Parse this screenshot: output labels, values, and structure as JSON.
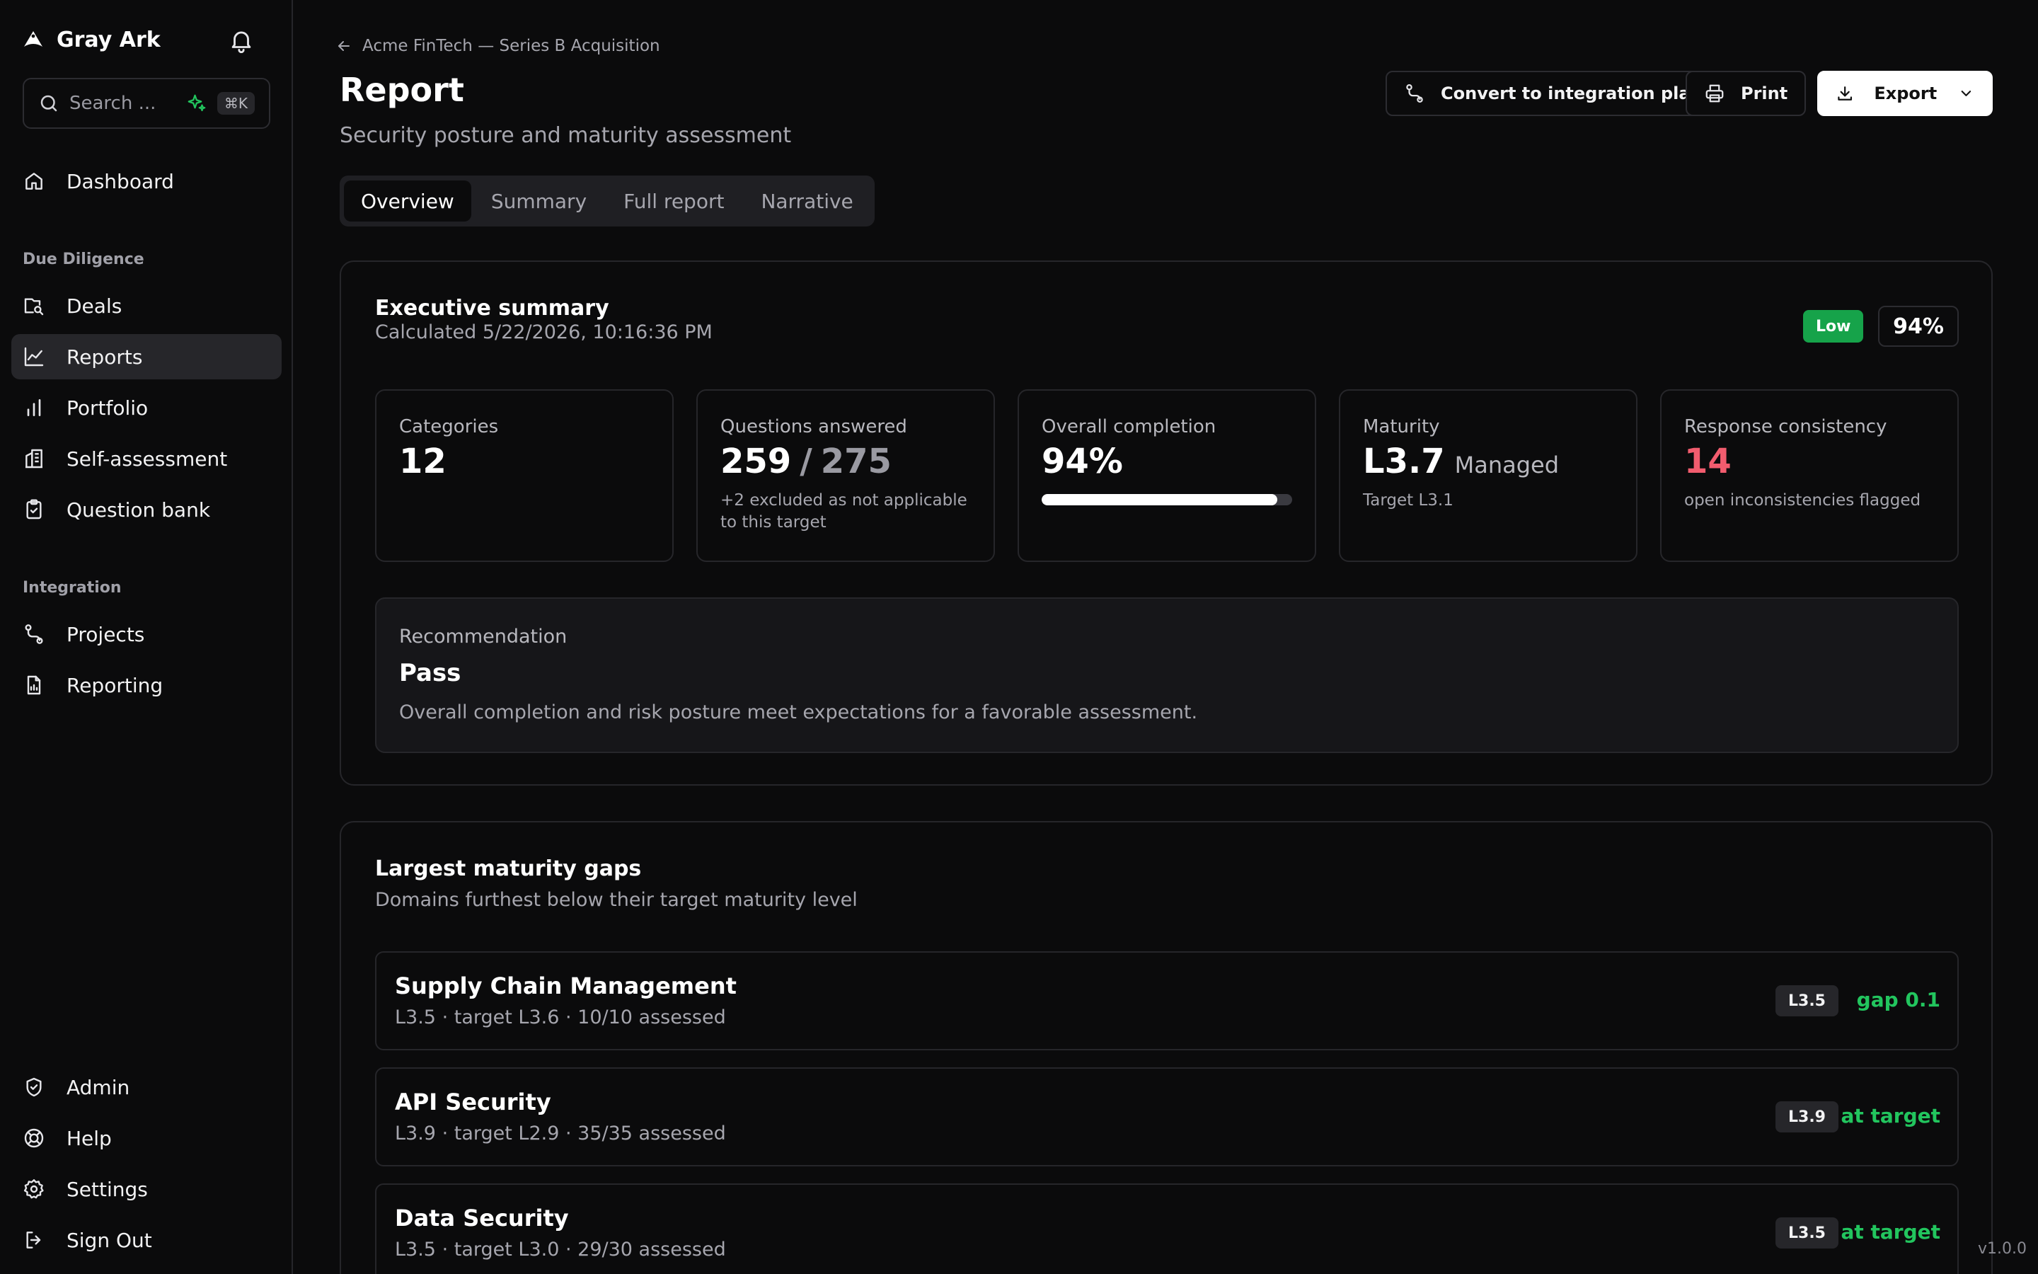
{
  "app": {
    "name": "Gray Ark",
    "version": "v1.0.0"
  },
  "sidebar": {
    "search_placeholder": "Search ...",
    "search_shortcut": "⌘K",
    "top_items": [
      {
        "label": "Dashboard",
        "icon": "home-icon"
      }
    ],
    "sections": [
      {
        "title": "Due Diligence",
        "items": [
          {
            "label": "Deals",
            "icon": "deals-icon"
          },
          {
            "label": "Reports",
            "icon": "chart-line-icon",
            "active": true
          },
          {
            "label": "Portfolio",
            "icon": "bar-chart-icon"
          },
          {
            "label": "Self-assessment",
            "icon": "building-icon"
          },
          {
            "label": "Question bank",
            "icon": "clipboard-check-icon"
          }
        ]
      },
      {
        "title": "Integration",
        "items": [
          {
            "label": "Projects",
            "icon": "route-icon"
          },
          {
            "label": "Reporting",
            "icon": "file-chart-icon"
          }
        ]
      }
    ],
    "bottom_items": [
      {
        "label": "Admin",
        "icon": "shield-check-icon"
      },
      {
        "label": "Help",
        "icon": "lifebuoy-icon"
      },
      {
        "label": "Settings",
        "icon": "gear-icon"
      },
      {
        "label": "Sign Out",
        "icon": "sign-out-icon"
      }
    ]
  },
  "header": {
    "breadcrumb": "Acme FinTech — Series B Acquisition",
    "title": "Report",
    "subtitle": "Security posture and maturity assessment",
    "actions": {
      "convert": "Convert to integration plan",
      "print": "Print",
      "export": "Export"
    }
  },
  "tabs": [
    {
      "label": "Overview",
      "active": true
    },
    {
      "label": "Summary"
    },
    {
      "label": "Full report"
    },
    {
      "label": "Narrative"
    }
  ],
  "executive_summary": {
    "title": "Executive summary",
    "calculated": "Calculated 5/22/2026, 10:16:36 PM",
    "risk_badge": "Low",
    "score": "94%",
    "stats": {
      "categories": {
        "label": "Categories",
        "value": "12"
      },
      "questions": {
        "label": "Questions answered",
        "answered": "259",
        "separator": "/",
        "total": "275",
        "note": "+2 excluded as not applicable to this target"
      },
      "completion": {
        "label": "Overall completion",
        "value": "94%",
        "progress": 0.94
      },
      "maturity": {
        "label": "Maturity",
        "value": "L3.7",
        "level_name": "Managed",
        "target": "Target L3.1"
      },
      "consistency": {
        "label": "Response consistency",
        "value": "14",
        "note": "open inconsistencies flagged"
      }
    },
    "recommendation": {
      "label": "Recommendation",
      "title": "Pass",
      "text": "Overall completion and risk posture meet expectations for a favorable assessment."
    }
  },
  "maturity_gaps": {
    "title": "Largest maturity gaps",
    "subtitle": "Domains furthest below their target maturity level",
    "rows": [
      {
        "name": "Supply Chain Management",
        "meta": "L3.5 · target L3.6 · 10/10 assessed",
        "level": "L3.5",
        "status": "gap 0.1"
      },
      {
        "name": "API Security",
        "meta": "L3.9 · target L2.9 · 35/35 assessed",
        "level": "L3.9",
        "status": "at target"
      },
      {
        "name": "Data Security",
        "meta": "L3.5 · target L3.0 · 29/30 assessed",
        "level": "L3.5",
        "status": "at target"
      }
    ]
  },
  "colors": {
    "accent_green": "#22c55e",
    "risk_low": "#16a34a",
    "alert_red": "#f25c6e",
    "background": "#0b0b0c"
  }
}
